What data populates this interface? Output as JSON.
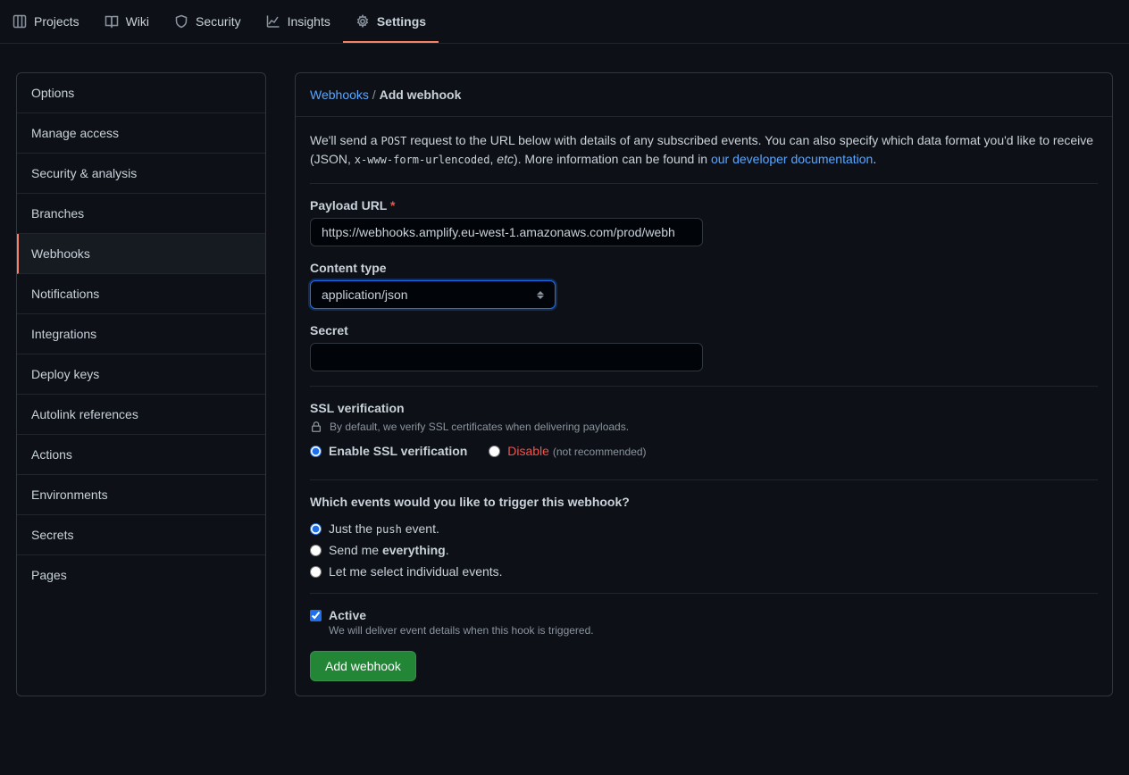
{
  "top_nav": {
    "items": [
      {
        "label": "Projects"
      },
      {
        "label": "Wiki"
      },
      {
        "label": "Security"
      },
      {
        "label": "Insights"
      },
      {
        "label": "Settings"
      }
    ]
  },
  "sidebar": {
    "items": [
      "Options",
      "Manage access",
      "Security & analysis",
      "Branches",
      "Webhooks",
      "Notifications",
      "Integrations",
      "Deploy keys",
      "Autolink references",
      "Actions",
      "Environments",
      "Secrets",
      "Pages"
    ]
  },
  "breadcrumb": {
    "root": "Webhooks",
    "sep": "/",
    "current": "Add webhook"
  },
  "intro": {
    "t1": "We'll send a ",
    "code1": "POST",
    "t2": " request to the URL below with details of any subscribed events. You can also specify which data format you'd like to receive (JSON, ",
    "code2": "x-www-form-urlencoded",
    "t3": ", ",
    "etc": "etc",
    "t4": "). More information can be found in ",
    "link": "our developer documentation",
    "t5": "."
  },
  "form": {
    "payload_url": {
      "label": "Payload URL",
      "value": "https://webhooks.amplify.eu-west-1.amazonaws.com/prod/webh"
    },
    "content_type": {
      "label": "Content type",
      "value": "application/json"
    },
    "secret": {
      "label": "Secret",
      "value": ""
    }
  },
  "ssl": {
    "title": "SSL verification",
    "note": "By default, we verify SSL certificates when delivering payloads.",
    "enable": "Enable SSL verification",
    "disable": "Disable",
    "not_rec": "(not recommended)"
  },
  "events": {
    "title": "Which events would you like to trigger this webhook?",
    "opt1_a": "Just the ",
    "opt1_code": "push",
    "opt1_b": " event.",
    "opt2_a": "Send me ",
    "opt2_strong": "everything",
    "opt2_b": ".",
    "opt3": "Let me select individual events."
  },
  "active": {
    "label": "Active",
    "desc": "We will deliver event details when this hook is triggered."
  },
  "submit": "Add webhook"
}
